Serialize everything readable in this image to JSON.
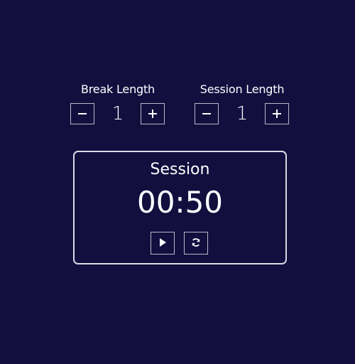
{
  "break": {
    "label": "Break Length",
    "value": "1",
    "decrement_icon": "minus-icon",
    "increment_icon": "plus-icon"
  },
  "session": {
    "label": "Session Length",
    "value": "1",
    "decrement_icon": "minus-icon",
    "increment_icon": "plus-icon"
  },
  "timer": {
    "label": "Session",
    "time": "00:50",
    "play_icon": "play-icon",
    "reset_icon": "refresh-icon"
  },
  "colors": {
    "background": "#120f3f",
    "text": "#ffffff",
    "border": "#d9d9e6"
  }
}
